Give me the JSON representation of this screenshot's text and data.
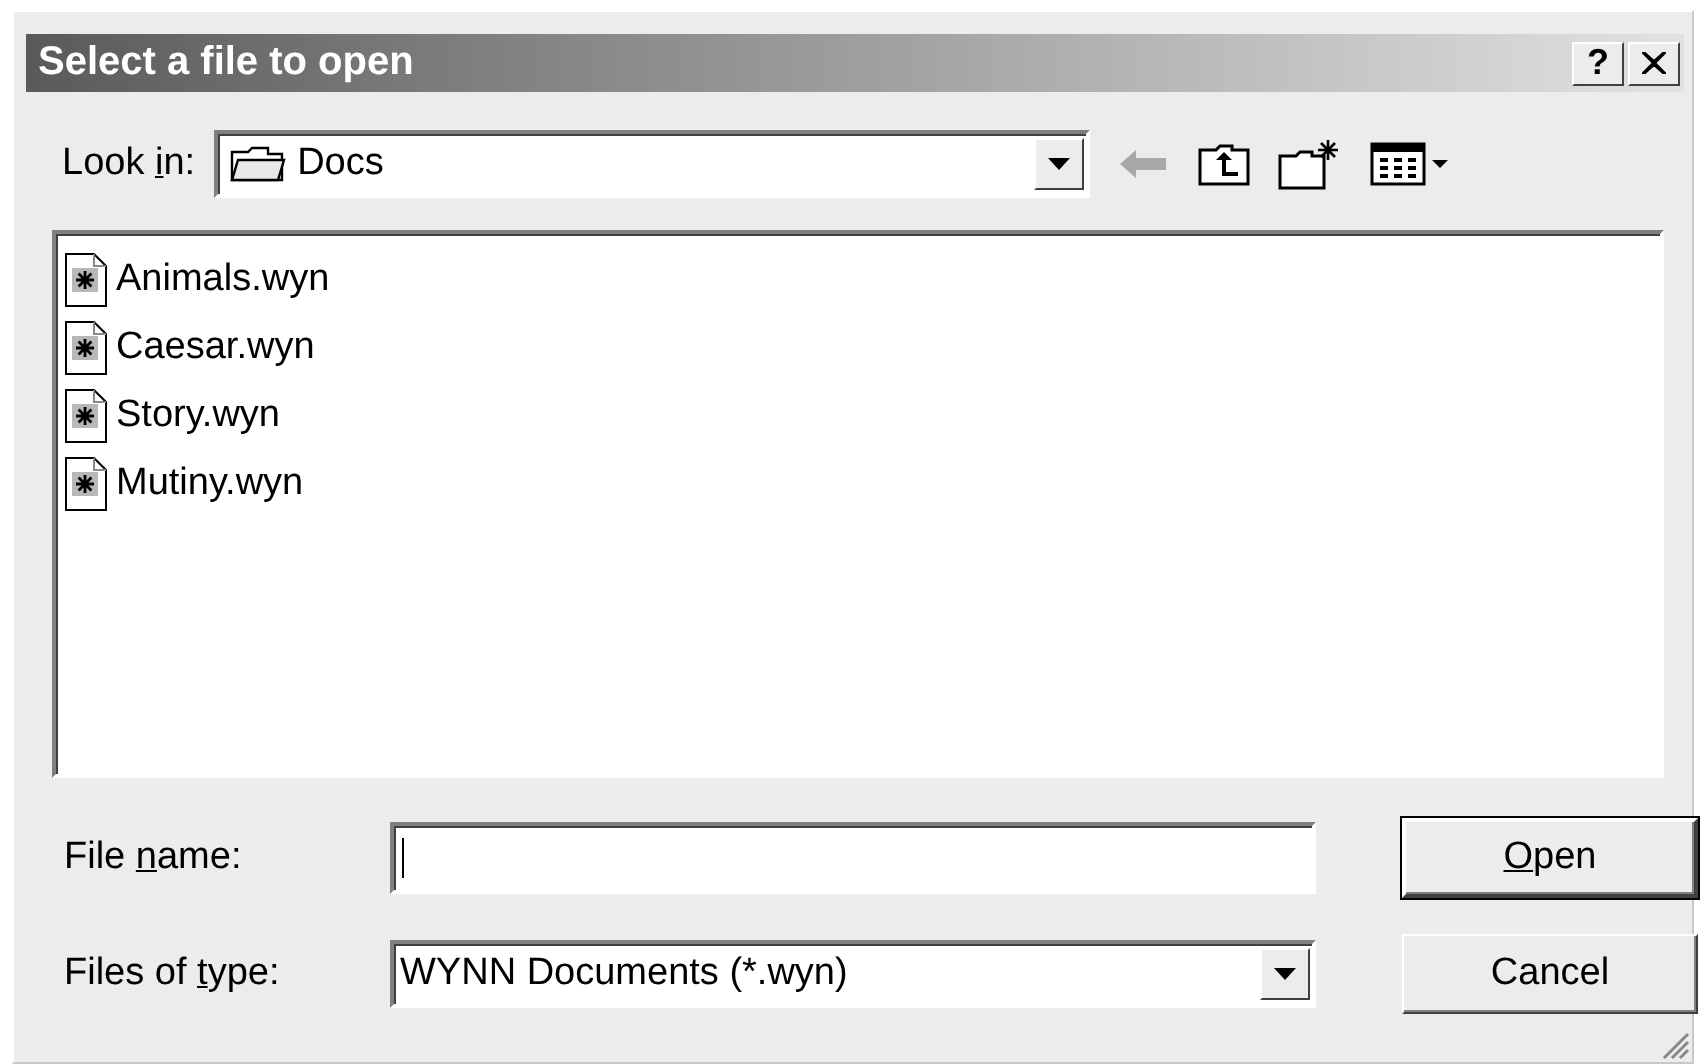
{
  "window": {
    "title": "Select a file to open",
    "title_buttons": [
      {
        "kind": "help",
        "label": "?"
      },
      {
        "kind": "close"
      }
    ]
  },
  "look_in": {
    "label": {
      "before": "Look ",
      "key": "i",
      "after": "n:"
    },
    "value": "Docs"
  },
  "toolbar": [
    {
      "kind": "back",
      "disabled": true
    },
    {
      "kind": "up",
      "disabled": false
    },
    {
      "kind": "new_folder",
      "disabled": false
    },
    {
      "kind": "views",
      "disabled": false
    }
  ],
  "files": [
    {
      "name": "Animals.wyn",
      "selected": false
    },
    {
      "name": "Caesar.wyn",
      "selected": false
    },
    {
      "name": "Story.wyn",
      "selected": false
    },
    {
      "name": "Mutiny.wyn",
      "selected": false
    }
  ],
  "file_name": {
    "label": {
      "before": "File ",
      "key": "n",
      "after": "ame:"
    },
    "focused": true
  },
  "file_type": {
    "label": {
      "before": "Files of ",
      "key": "t",
      "after": "ype:"
    },
    "value": "WYNN Documents (*.wyn)"
  },
  "buttons": [
    {
      "label": {
        "key": "O",
        "after": "pen"
      },
      "default": true
    },
    {
      "label": {
        "after": "Cancel"
      },
      "default": false
    }
  ]
}
